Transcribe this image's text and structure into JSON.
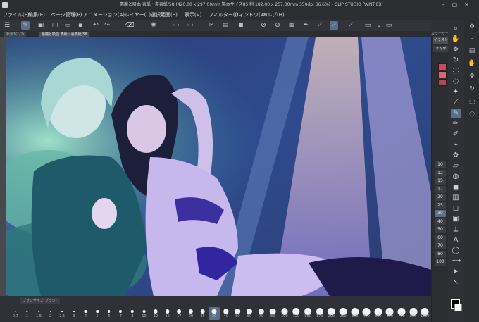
{
  "window": {
    "title": "悪魔と吸血 表紙・裏表紙/58 (420.00 x 297.00mm 製本サイズ85 判 182.00 x 257.00mm 350dpi 66.6%) - CLIP STUDIO PAINT EX"
  },
  "menu": [
    "ファイル(F)",
    "編集(E)",
    "ページ管理(P)",
    "アニメーション(A)",
    "レイヤー(L)",
    "選択範囲(S)",
    "表示(V)",
    "フィルター(I)",
    "ウィンドウ(W)",
    "ヘルプ(H)"
  ],
  "toolbar": {
    "icons": [
      "menu-icon",
      "pen-icon",
      "box-icon",
      "new-icon",
      "folder-icon",
      "save-icon",
      "undo-icon",
      "redo-icon",
      "clear-icon",
      "transform-icon",
      "cut-icon",
      "copy-icon",
      "paste-icon",
      "fill-icon",
      "snap-icon",
      "ruler-icon",
      "pen-mode-icon",
      "layer-mode-icon",
      "settings-icon"
    ]
  },
  "tabs": [
    {
      "label": "新規1(1/2)",
      "active": false
    },
    {
      "label": "悪魔と吸血 表紙・裏表紙/58",
      "active": true
    }
  ],
  "right_panel": {
    "tab_label": "カラーサークル",
    "subtool_tabs": [
      "イラスト",
      "まんが"
    ]
  },
  "brush_size_palette": {
    "title": "ブラシサイズ(ブラシ)",
    "sizes": [
      "0.7",
      "1",
      "1.5",
      "2",
      "2.5",
      "3",
      "4",
      "5",
      "6",
      "7",
      "8",
      "10",
      "12",
      "15",
      "17",
      "20",
      "25",
      "30",
      "40",
      "50",
      "60",
      "70",
      "80",
      "100",
      "120",
      "150",
      "170",
      "200",
      "250",
      "300",
      "400",
      "500",
      "600",
      "700",
      "800",
      "1000"
    ],
    "selected": "30"
  },
  "size_column": {
    "values": [
      "10",
      "12",
      "15",
      "17",
      "20",
      "25",
      "30",
      "40",
      "50",
      "60",
      "70",
      "80",
      "100"
    ],
    "selected": "30"
  },
  "tools": [
    "zoom-icon",
    "hand-icon",
    "move-icon",
    "rotate-icon",
    "select-icon",
    "lasso-icon",
    "magic-wand-icon",
    "eyedropper-icon",
    "pen-icon",
    "pencil-icon",
    "brush-icon",
    "airbrush-icon",
    "decoration-icon",
    "eraser-icon",
    "blend-icon",
    "fill-icon",
    "gradient-icon",
    "figure-icon",
    "frame-icon",
    "ruler-icon",
    "text-icon",
    "balloon-icon",
    "line-correction-icon",
    "object-icon",
    "operation-icon"
  ],
  "colors": {
    "main_color": "#000000",
    "sub_color": "#ffffff",
    "accent": "#5c6f8a"
  }
}
